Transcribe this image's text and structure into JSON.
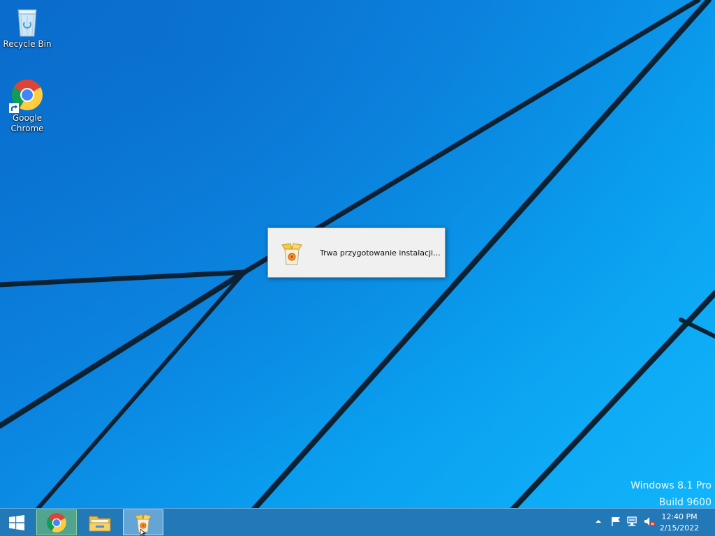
{
  "desktop": {
    "icons": [
      {
        "label": "Recycle Bin",
        "icon": "recycle-bin-icon"
      },
      {
        "label": "Google\nChrome",
        "icon": "chrome-icon"
      }
    ]
  },
  "dialog": {
    "message": "Trwa przygotowanie instalacji...",
    "icon": "installer-icon"
  },
  "watermark": {
    "edition": "Windows 8.1 Pro",
    "build": "Build 9600"
  },
  "taskbar": {
    "start_icon": "windows-logo-icon",
    "pinned": [
      {
        "name": "Google Chrome",
        "icon": "chrome-icon",
        "state": "running"
      },
      {
        "name": "File Explorer",
        "icon": "folder-icon",
        "state": "pinned"
      },
      {
        "name": "Installer",
        "icon": "installer-icon",
        "state": "active"
      }
    ],
    "tray": {
      "icons": [
        "chevron-up-icon",
        "flag-icon",
        "network-icon",
        "speaker-muted-icon"
      ],
      "time": "12:40 PM",
      "date": "2/15/2022"
    }
  },
  "colors": {
    "accent": "#0b86e2",
    "taskbar": "#2378b8",
    "dialog_bg": "#f0f0f0"
  }
}
